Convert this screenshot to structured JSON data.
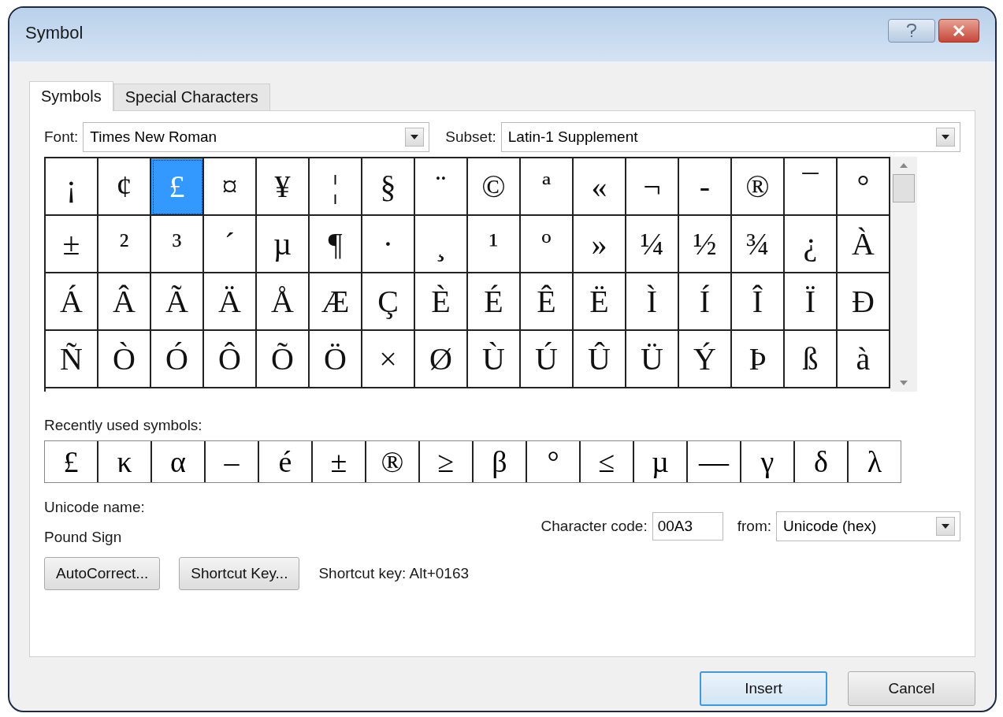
{
  "window": {
    "title": "Symbol"
  },
  "tabs": [
    {
      "label": "Symbols",
      "selected": true
    },
    {
      "label": "Special Characters",
      "selected": false
    }
  ],
  "font": {
    "label": "Font:",
    "value": "Times New Roman"
  },
  "subset": {
    "label": "Subset:",
    "value": "Latin-1 Supplement"
  },
  "grid": [
    [
      {
        "char": "¡",
        "selected": false
      },
      {
        "char": "¢",
        "selected": false
      },
      {
        "char": "£",
        "selected": true
      },
      {
        "char": "¤",
        "selected": false
      },
      {
        "char": "¥",
        "selected": false
      },
      {
        "char": "¦",
        "selected": false
      },
      {
        "char": "§",
        "selected": false
      },
      {
        "char": "¨",
        "selected": false
      },
      {
        "char": "©",
        "selected": false
      },
      {
        "char": "ª",
        "selected": false
      },
      {
        "char": "«",
        "selected": false
      },
      {
        "char": "¬",
        "selected": false
      },
      {
        "char": "-",
        "selected": false
      },
      {
        "char": "®",
        "selected": false
      },
      {
        "char": "¯",
        "selected": false
      },
      {
        "char": "°",
        "selected": false
      }
    ],
    [
      {
        "char": "±",
        "selected": false
      },
      {
        "char": "²",
        "selected": false
      },
      {
        "char": "³",
        "selected": false
      },
      {
        "char": "´",
        "selected": false
      },
      {
        "char": "µ",
        "selected": false
      },
      {
        "char": "¶",
        "selected": false
      },
      {
        "char": "·",
        "selected": false
      },
      {
        "char": "¸",
        "selected": false
      },
      {
        "char": "¹",
        "selected": false
      },
      {
        "char": "º",
        "selected": false
      },
      {
        "char": "»",
        "selected": false
      },
      {
        "char": "¼",
        "selected": false
      },
      {
        "char": "½",
        "selected": false
      },
      {
        "char": "¾",
        "selected": false
      },
      {
        "char": "¿",
        "selected": false
      },
      {
        "char": "À",
        "selected": false
      }
    ],
    [
      {
        "char": "Á",
        "selected": false
      },
      {
        "char": "Â",
        "selected": false
      },
      {
        "char": "Ã",
        "selected": false
      },
      {
        "char": "Ä",
        "selected": false
      },
      {
        "char": "Å",
        "selected": false
      },
      {
        "char": "Æ",
        "selected": false
      },
      {
        "char": "Ç",
        "selected": false
      },
      {
        "char": "È",
        "selected": false
      },
      {
        "char": "É",
        "selected": false
      },
      {
        "char": "Ê",
        "selected": false
      },
      {
        "char": "Ë",
        "selected": false
      },
      {
        "char": "Ì",
        "selected": false
      },
      {
        "char": "Í",
        "selected": false
      },
      {
        "char": "Î",
        "selected": false
      },
      {
        "char": "Ï",
        "selected": false
      },
      {
        "char": "Ð",
        "selected": false
      }
    ],
    [
      {
        "char": "Ñ",
        "selected": false
      },
      {
        "char": "Ò",
        "selected": false
      },
      {
        "char": "Ó",
        "selected": false
      },
      {
        "char": "Ô",
        "selected": false
      },
      {
        "char": "Õ",
        "selected": false
      },
      {
        "char": "Ö",
        "selected": false
      },
      {
        "char": "×",
        "selected": false
      },
      {
        "char": "Ø",
        "selected": false
      },
      {
        "char": "Ù",
        "selected": false
      },
      {
        "char": "Ú",
        "selected": false
      },
      {
        "char": "Û",
        "selected": false
      },
      {
        "char": "Ü",
        "selected": false
      },
      {
        "char": "Ý",
        "selected": false
      },
      {
        "char": "Þ",
        "selected": false
      },
      {
        "char": "ß",
        "selected": false
      },
      {
        "char": "à",
        "selected": false
      }
    ]
  ],
  "recent": {
    "label": "Recently used symbols:",
    "symbols": [
      "£",
      "κ",
      "α",
      "–",
      "é",
      "±",
      "®",
      "≥",
      "β",
      "°",
      "≤",
      "µ",
      "—",
      "γ",
      "δ",
      "λ"
    ]
  },
  "unicode_name": {
    "label": "Unicode name:",
    "value": "Pound Sign"
  },
  "character_code": {
    "label": "Character code:",
    "value": "00A3"
  },
  "from": {
    "label": "from:",
    "value": "Unicode (hex)"
  },
  "buttons": [
    "AutoCorrect...",
    "Shortcut Key..."
  ],
  "shortcut_text": "Shortcut key: Alt+0163",
  "footer_buttons": [
    {
      "label": "Insert",
      "default": true
    },
    {
      "label": "Cancel",
      "default": false
    }
  ]
}
